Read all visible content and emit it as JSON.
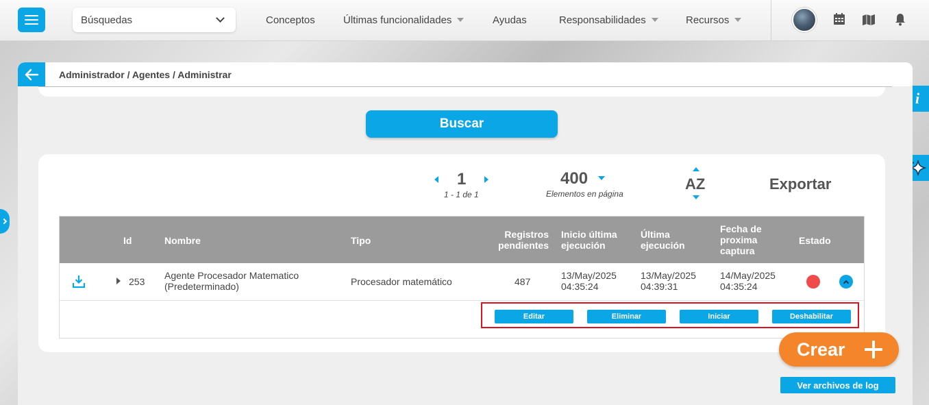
{
  "topbar": {
    "search_value": "Búsquedas",
    "nav": [
      {
        "label": "Conceptos",
        "has_caret": false
      },
      {
        "label": "Últimas funcionalidades",
        "has_caret": true
      },
      {
        "label": "Ayudas",
        "has_caret": false
      },
      {
        "label": "Responsabilidades",
        "has_caret": true
      },
      {
        "label": "Recursos",
        "has_caret": true
      }
    ],
    "icons": [
      "menu-icon",
      "calendar-icon",
      "map-icon",
      "bell-icon"
    ]
  },
  "side": {
    "info_label": "i"
  },
  "panel": {
    "breadcrumb": "Administrador / Agentes / Administrar",
    "search_button": "Buscar"
  },
  "pagination": {
    "page": "1",
    "range": "1 - 1 de 1",
    "per_page": "400",
    "per_page_label": "Elementos en página",
    "sort_label": "AZ",
    "export_label": "Exportar"
  },
  "table": {
    "headers": {
      "id": "Id",
      "name": "Nombre",
      "type": "Tipo",
      "pending": [
        "Registros",
        "pendientes"
      ],
      "start": [
        "Inicio última",
        "ejecución"
      ],
      "last": [
        "Última",
        "ejecución"
      ],
      "next": [
        "Fecha de",
        "proxima",
        "captura"
      ],
      "status": "Estado"
    },
    "rows": [
      {
        "id": "253",
        "name": [
          "Agente Procesador Matematico",
          "(Predeterminado)"
        ],
        "type": "Procesador matemático",
        "pending": "487",
        "start": [
          "13/May/2025",
          "04:35:24"
        ],
        "last": [
          "13/May/2025",
          "04:39:31"
        ],
        "next": [
          "14/May/2025",
          "04:35:24"
        ],
        "status_color": "#f04b4b"
      }
    ],
    "actions": [
      "Editar",
      "Eliminar",
      "Iniciar",
      "Deshabilitar"
    ]
  },
  "fab": {
    "create_label": "Crear",
    "log_label": "Ver archivos de log"
  },
  "colors": {
    "accent": "#0aa6e6",
    "create": "#f5852a",
    "highlight": "#e0101e"
  }
}
